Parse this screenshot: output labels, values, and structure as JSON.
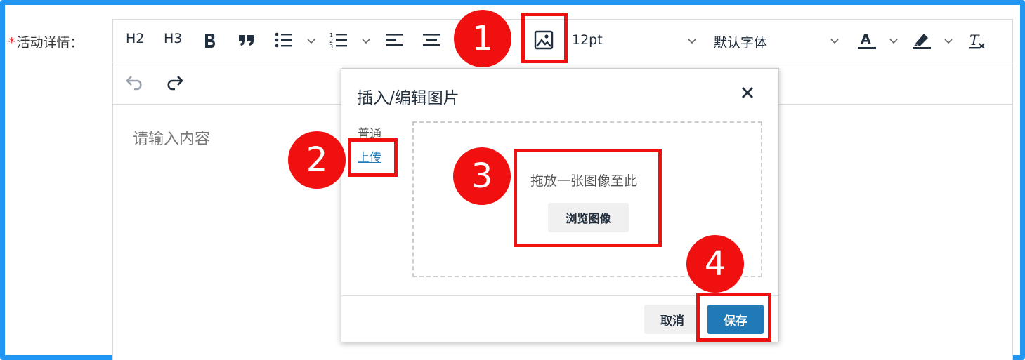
{
  "form": {
    "required_mark": "*",
    "label": "活动详情："
  },
  "toolbar": {
    "h2": "H2",
    "h3": "H3",
    "font_size": "12pt",
    "font_family": "默认字体",
    "icons": [
      "bold-icon",
      "blockquote-icon",
      "bullet-list-icon",
      "numbered-list-icon",
      "align-left-icon",
      "align-center-icon",
      "image-icon",
      "text-color-icon",
      "highlight-icon",
      "clear-format-icon",
      "undo-icon",
      "redo-icon"
    ]
  },
  "editor": {
    "placeholder": "请输入内容"
  },
  "dialog": {
    "title": "插入/编辑图片",
    "tabs": [
      "普通",
      "上传"
    ],
    "active_tab": "上传",
    "drop_text": "拖放一张图像至此",
    "browse_label": "浏览图像",
    "cancel_label": "取消",
    "save_label": "保存"
  },
  "annotations": {
    "steps": [
      "1",
      "2",
      "3",
      "4"
    ],
    "color": "#f01010"
  },
  "colors": {
    "frame": "#2196f3",
    "primary": "#207ab7"
  }
}
